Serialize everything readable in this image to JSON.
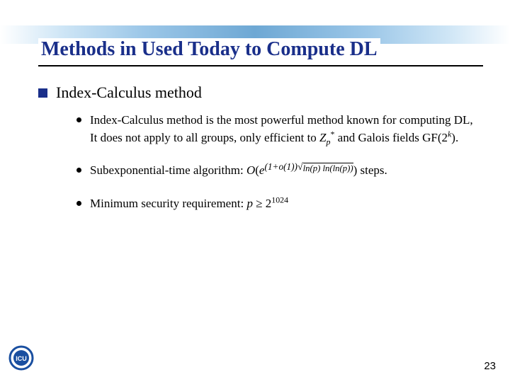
{
  "title": "Methods in Used Today to Compute DL",
  "heading": "Index-Calculus method",
  "bullets": {
    "b1_a": "Index-Calculus method is the most powerful method known for computing DL, It does not apply to all groups, only efficient to ",
    "b1_zp": "Z",
    "b1_p": "p",
    "b1_star": "*",
    "b1_b": " and Galois fields GF(2",
    "b1_k": "k",
    "b1_c": ").",
    "b2_a": "Subexponential-time algorithm: ",
    "b2_O": "O",
    "b2_open": "(",
    "b2_e": "e",
    "b2_exp_a": "(1+",
    "b2_exp_o": "o",
    "b2_exp_b": "(1))",
    "b2_exp_rad": "ln(p) ln(ln(p))",
    "b2_close": ")",
    "b2_tail": " steps.",
    "b3_a": "Minimum security requirement: ",
    "b3_p": "p",
    "b3_ge": " ≥ 2",
    "b3_exp": "1024"
  },
  "logo_text": "ICU",
  "page_number": "23"
}
